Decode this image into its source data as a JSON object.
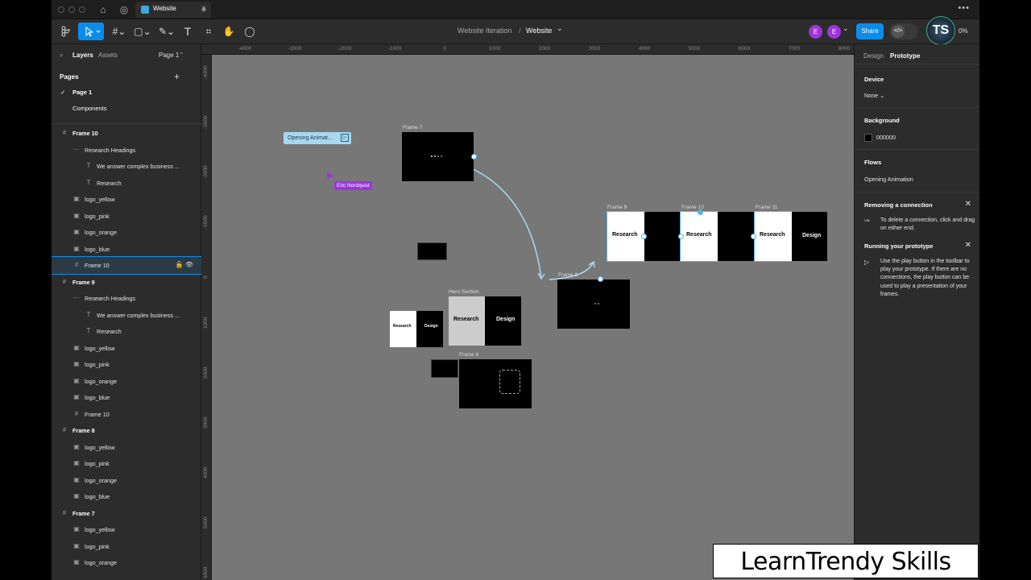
{
  "titlebar": {
    "tab_title": "Website",
    "tab_close": "×",
    "new_tab": "+",
    "more": "•••"
  },
  "toolbar": {
    "breadcrumb_project": "Website Iteration",
    "breadcrumb_sep": "/",
    "breadcrumb_file": "Website",
    "breadcrumb_chevron": "⌄",
    "avatars": [
      "E",
      "E"
    ],
    "share_label": "Share",
    "dev_mode_icon": "</>",
    "zoom": "0%"
  },
  "left_panel": {
    "tab_layers": "Layers",
    "tab_assets": "Assets",
    "page_selector": "Page 1",
    "pages_heading": "Pages",
    "pages": [
      "Page 1",
      "Components"
    ],
    "layers": [
      {
        "name": "Frame 10",
        "icon": "#",
        "indent": 0,
        "bold": true
      },
      {
        "name": "Research Headings",
        "icon": "⋯",
        "indent": 1
      },
      {
        "name": "We answer complex business ...",
        "icon": "T",
        "indent": 2
      },
      {
        "name": "Research",
        "icon": "T",
        "indent": 2
      },
      {
        "name": "logo_yellow",
        "icon": "▣",
        "indent": 1
      },
      {
        "name": "logo_pink",
        "icon": "▣",
        "indent": 1
      },
      {
        "name": "logo_orange",
        "icon": "▣",
        "indent": 1
      },
      {
        "name": "logo_blue",
        "icon": "▣",
        "indent": 1
      },
      {
        "name": "Frame 10",
        "icon": "#",
        "indent": 1,
        "selected": true
      },
      {
        "name": "Frame 9",
        "icon": "#",
        "indent": 0,
        "bold": true
      },
      {
        "name": "Research Headings",
        "icon": "⋯",
        "indent": 1
      },
      {
        "name": "We answer complex business ...",
        "icon": "T",
        "indent": 2
      },
      {
        "name": "Research",
        "icon": "T",
        "indent": 2
      },
      {
        "name": "logo_yellow",
        "icon": "▣",
        "indent": 1
      },
      {
        "name": "logo_pink",
        "icon": "▣",
        "indent": 1
      },
      {
        "name": "logo_orange",
        "icon": "▣",
        "indent": 1
      },
      {
        "name": "logo_blue",
        "icon": "▣",
        "indent": 1
      },
      {
        "name": "Frame 10",
        "icon": "#",
        "indent": 1
      },
      {
        "name": "Frame 8",
        "icon": "#",
        "indent": 0,
        "bold": true
      },
      {
        "name": "logo_yellow",
        "icon": "▣",
        "indent": 1
      },
      {
        "name": "logo_pink",
        "icon": "▣",
        "indent": 1
      },
      {
        "name": "logo_orange",
        "icon": "▣",
        "indent": 1
      },
      {
        "name": "logo_blue",
        "icon": "▣",
        "indent": 1
      },
      {
        "name": "Frame 7",
        "icon": "#",
        "indent": 0,
        "bold": true
      },
      {
        "name": "logo_yellow",
        "icon": "▣",
        "indent": 1
      },
      {
        "name": "logo_pink",
        "icon": "▣",
        "indent": 1
      },
      {
        "name": "logo_orange",
        "icon": "▣",
        "indent": 1
      }
    ]
  },
  "canvas": {
    "ruler_top": [
      "-4000",
      "-3000",
      "-2000",
      "-1000",
      "0",
      "1000",
      "2000",
      "3000",
      "4000",
      "5000",
      "6000",
      "7000",
      "8000"
    ],
    "ruler_left": [
      "-4000",
      "-3000",
      "-2000",
      "-1000",
      "0",
      "1000",
      "2000",
      "3000",
      "4000",
      "5000",
      "6000"
    ],
    "frame_labels": {
      "frame7": "Frame 7",
      "frame8": "Frame 8",
      "frame9": "Frame 9",
      "frame10": "Frame 10",
      "frame11": "Frame 11",
      "hero": "Hero Section",
      "frame6": "Frame 6"
    },
    "research": "Research",
    "design": "Design",
    "flow_badge": "Opening Animat...",
    "collaborator": "Eric Nordquist"
  },
  "right_panel": {
    "tab_design": "Design",
    "tab_prototype": "Prototype",
    "device_heading": "Device",
    "device_value": "None",
    "background_heading": "Background",
    "background_value": "000000",
    "flows_heading": "Flows",
    "flow_name": "Opening Animation",
    "tip1_title": "Removing a connection",
    "tip1_body": "To delete a connection, click and drag on either end.",
    "tip2_title": "Running your prototype",
    "tip2_body": "Use the play button in the toolbar to play your prototype. If there are no connections, the play button can be used to play a presentation of your frames."
  },
  "watermark": "LearnTrendy Skills",
  "colors": {
    "accent": "#0c8ce9",
    "avatar": "#9b37d9",
    "canvas": "#777777",
    "panel": "#2c2c2c",
    "flow_line": "#a8d8f0"
  }
}
